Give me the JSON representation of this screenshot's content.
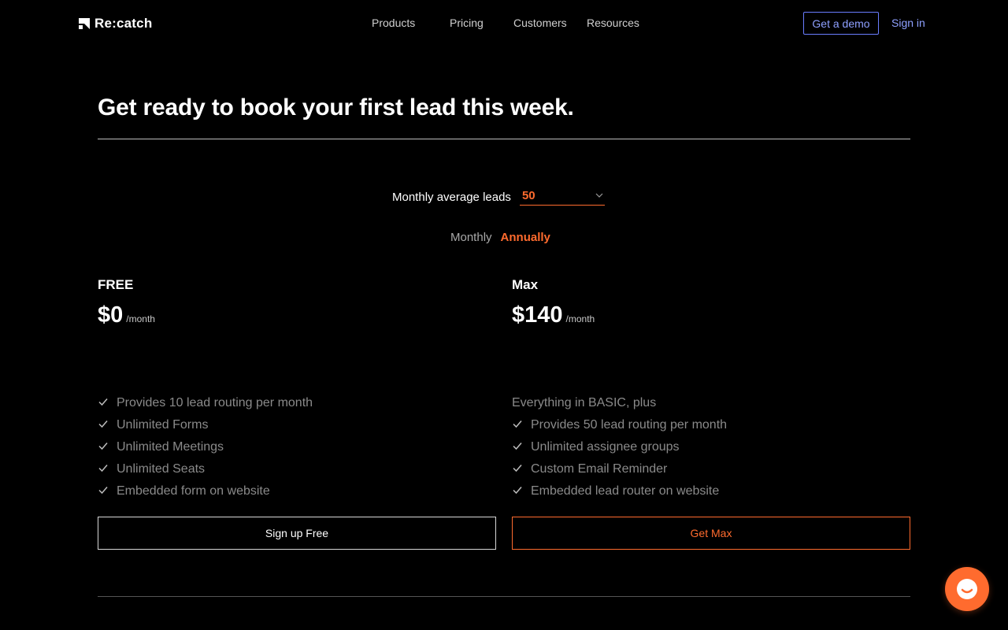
{
  "brand": {
    "name": "Re:catch",
    "icon": "recatch-logo-icon"
  },
  "nav": {
    "items": [
      {
        "label": "Products"
      },
      {
        "label": "Pricing"
      },
      {
        "label": "Customers"
      },
      {
        "label": "Resources"
      }
    ],
    "demo_label": "Get a demo",
    "signin_label": "Sign in"
  },
  "page": {
    "title": "Get ready to book your first lead this week."
  },
  "leads": {
    "label": "Monthly average leads",
    "value": "50"
  },
  "billing": {
    "monthly": "Monthly",
    "annually": "Annually",
    "selected": "Annually"
  },
  "plans": [
    {
      "name": "FREE",
      "price": "$0",
      "per": "/month",
      "features": [
        "Provides 10 lead routing per month",
        "Unlimited Forms",
        "Unlimited Meetings",
        "Unlimited Seats",
        "Embedded form on website"
      ],
      "cta": "Sign up Free"
    },
    {
      "name": "Max",
      "price": "$140",
      "per": "/month",
      "intro": "Everything in BASIC, plus",
      "features": [
        "Provides 50 lead routing per month",
        "Unlimited assignee groups",
        "Custom Email Reminder",
        "Embedded lead router on website"
      ],
      "cta": "Get Max"
    }
  ],
  "colors": {
    "accent": "#ff6b2e",
    "link": "#8ea0ff",
    "background": "#000000"
  },
  "chat": {
    "icon": "chat-bubble-icon"
  }
}
